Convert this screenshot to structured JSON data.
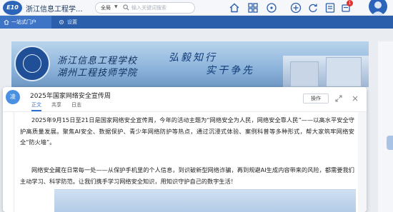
{
  "header": {
    "logo_text": "E10",
    "app_title": "浙江信息工程学...",
    "search_scope": "全局",
    "search_placeholder": "输入关键词搜索",
    "notification_count": "1",
    "icons": [
      "home-icon",
      "grid-icon",
      "bubble-icon",
      "plus-icon",
      "refresh-icon",
      "list-icon",
      "bell-icon",
      "avatar"
    ]
  },
  "tabs": [
    {
      "label": "一站式门户",
      "icon": "home-icon"
    },
    {
      "label": "设置",
      "icon": "gear-icon"
    }
  ],
  "banner": {
    "school_line1": "浙江信息工程学校",
    "school_line2": "湖州工程技师学院",
    "motto_line1": "弘毅知行",
    "motto_line2": "实干争先"
  },
  "modal": {
    "icon_text": "凌",
    "title": "2025年国家网络安全宣传周",
    "operate_label": "操作",
    "tabs": [
      "正文",
      "共享",
      "日志"
    ],
    "active_tab": 0,
    "paragraphs": [
      "2025年9月15日至21日是国家网络安全宣传周，今年的活动主题为“网络安全为人民，网络安全靠人民”——以高水平安全守护高质量发展。聚焦AI安全、数据保护、青少年网络防护等热点，通过沉浸式体验、案例科普等多种形式，帮大家筑牢网络安全“防火墙”。",
      "网络安全藏在日常每一处——从保护手机里的个人信息，到识破新型网络诈骗，再到规避AI生成内容带来的风险，都需要我们主动学习、科学防范。让我们携手学习网络安全知识，用知识守护自己的数字生活！"
    ]
  },
  "colors": {
    "brand": "#2c5fab",
    "accent": "#2f6fd0",
    "badge": "#e03131"
  }
}
